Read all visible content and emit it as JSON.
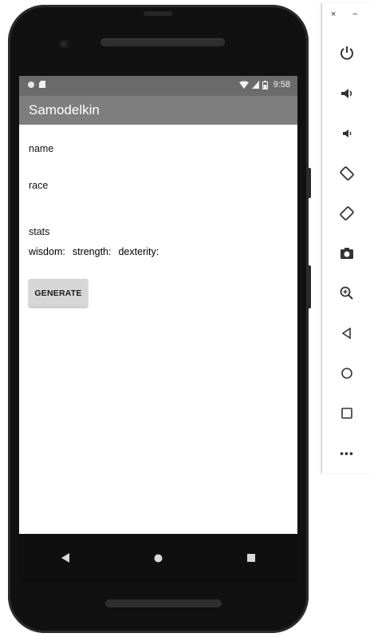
{
  "status_bar": {
    "time": "9:58"
  },
  "app": {
    "title": "Samodelkin"
  },
  "form": {
    "name_label": "name",
    "race_label": "race",
    "stats_label": "stats",
    "wisdom_label": "wisdom:",
    "strength_label": "strength:",
    "dexterity_label": "dexterity:",
    "generate_button": "GENERATE"
  },
  "emulator_panel": {
    "close_glyph": "×",
    "minimize_glyph": "−",
    "tools": [
      "power-icon",
      "volume-up-icon",
      "volume-down-icon",
      "rotate-left-icon",
      "rotate-right-icon",
      "camera-icon",
      "zoom-icon",
      "back-icon",
      "home-icon",
      "overview-icon",
      "more-icon"
    ],
    "more_glyph": "•••"
  },
  "colors": {
    "app_bar": "#7e7e7e",
    "status_bar": "#6b6b6b",
    "button": "#d6d6d6"
  }
}
